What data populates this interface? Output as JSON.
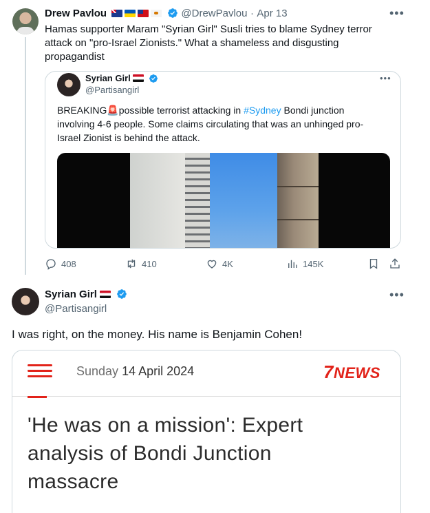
{
  "tweet1": {
    "author_name": "Drew Pavlou",
    "handle": "@DrewPavlou",
    "separator": "·",
    "date": "Apr 13",
    "flags": [
      "australia-flag",
      "ukraine-flag",
      "taiwan-flag",
      "cyprus-flag"
    ],
    "text_line1": "Hamas supporter Maram \"Syrian Girl\" Susli tries to blame Sydney terror",
    "text_line2": "attack on \"pro-Israel Zionists.\" What a shameless and disgusting",
    "text_line3": "propagandist",
    "quote": {
      "author_name": "Syrian Girl",
      "flag": "syria-flag",
      "handle": "@Partisangirl",
      "text_prefix": "BREAKING",
      "text_emoji": "🚨",
      "text_line1_rest": "possible terrorist attacking in ",
      "hashtag": "#Sydney",
      "text_line1_end": " Bondi junction",
      "text_line2": "involving 4-6 people. Some claims circulating that was an unhinged pro-",
      "text_line3": "Israel Zionist is behind the attack."
    },
    "actions": {
      "replies": "408",
      "reposts": "410",
      "likes": "4K",
      "views": "145K"
    }
  },
  "tweet2": {
    "author_name": "Syrian Girl",
    "flag": "syria-flag",
    "handle": "@Partisangirl",
    "text": "I was right, on the money. His name is Benjamin Cohen!",
    "news": {
      "date_prefix": "Sunday",
      "date_rest": "14 April 2024",
      "logo_num": "7",
      "logo_text": "NEWS",
      "headline_line1": "'He was on a mission': Expert",
      "headline_line2": "analysis of Bondi Junction",
      "headline_line3": "massacre"
    }
  },
  "colors": {
    "link_blue": "#1d9bf0",
    "secondary_text": "#536471",
    "border": "#cfd9de",
    "news_red": "#e2231a"
  }
}
